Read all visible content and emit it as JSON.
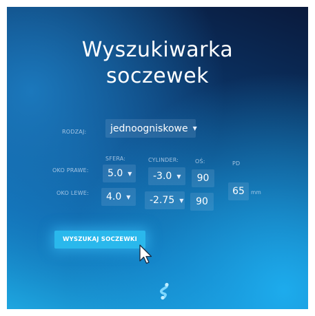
{
  "title": "Wyszukiwarka\nsoczewek",
  "form": {
    "type_label": "RODZAJ:",
    "type_value": "jednoogniskowe",
    "columns": {
      "sphere": "SFERA:",
      "cylinder": "CYLINDER:",
      "axis": "OŚ:",
      "pd": "PD"
    },
    "right_eye": {
      "label": "OKO PRAWE:",
      "sphere": "5.0",
      "cylinder": "-3.0",
      "axis": "90"
    },
    "left_eye": {
      "label": "OKO LEWE:",
      "sphere": "4.0",
      "cylinder": "-2.75",
      "axis": "90"
    },
    "pd_value": "65",
    "pd_unit": "mm"
  },
  "search_button": "WYSZUKAJ SOCZEWKI",
  "icons": {
    "dropdown": "chevron-down-icon",
    "cursor": "mouse-pointer-icon",
    "logo": "brand-logo-icon"
  },
  "colors": {
    "accent": "#2ab8ec",
    "background_dark": "#0a1a3c",
    "background_light": "#1ea6e0"
  }
}
